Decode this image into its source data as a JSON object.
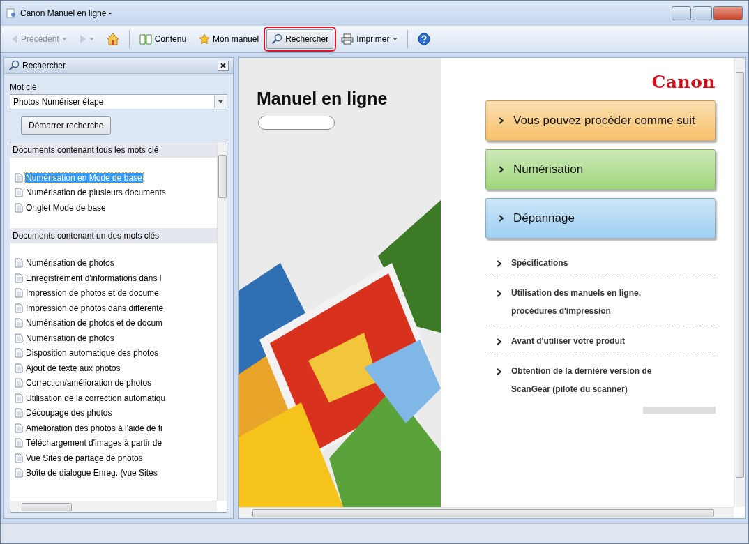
{
  "window": {
    "title": "Canon Manuel en ligne -"
  },
  "toolbar": [
    {
      "kind": "back",
      "label": "Précédent",
      "disabled": true,
      "selected": false
    },
    {
      "kind": "forward",
      "disabled": true,
      "selected": false
    },
    {
      "kind": "home",
      "disabled": false,
      "selected": false
    },
    {
      "kind": "contents",
      "label": "Contenu",
      "disabled": false,
      "selected": false
    },
    {
      "kind": "favorites",
      "label": "Mon manuel",
      "disabled": false,
      "selected": false
    },
    {
      "kind": "search",
      "label": "Rechercher",
      "disabled": false,
      "selected": true
    },
    {
      "kind": "print",
      "label": "Imprimer",
      "disabled": false,
      "selected": false
    },
    {
      "kind": "help",
      "disabled": false,
      "selected": false
    }
  ],
  "search_panel": {
    "title": "Rechercher",
    "keyword_label": "Mot clé",
    "keyword_value": "Photos Numériser étape",
    "start_button": "Démarrer recherche",
    "groups": [
      {
        "heading": "Documents contenant tous les mots clé",
        "items": [
          {
            "label": "Numérisation en Mode de base",
            "selected": true
          },
          {
            "label": "Numérisation de plusieurs documents",
            "selected": false
          },
          {
            "label": "Onglet Mode de base",
            "selected": false
          }
        ]
      },
      {
        "heading": "Documents contenant un des mots clés",
        "items": [
          {
            "label": "Numérisation de photos",
            "selected": false
          },
          {
            "label": "Enregistrement d'informations dans l",
            "selected": false
          },
          {
            "label": "Impression de photos et de docume",
            "selected": false
          },
          {
            "label": "Impression de photos dans différente",
            "selected": false
          },
          {
            "label": "Numérisation de photos et de docum",
            "selected": false
          },
          {
            "label": "Numérisation de photos",
            "selected": false
          },
          {
            "label": "Disposition automatique des photos",
            "selected": false
          },
          {
            "label": "Ajout de texte aux photos",
            "selected": false
          },
          {
            "label": "Correction/amélioration de photos",
            "selected": false
          },
          {
            "label": "Utilisation de la correction automatiqu",
            "selected": false
          },
          {
            "label": "Découpage des photos",
            "selected": false
          },
          {
            "label": "Amélioration des photos à l'aide de fi",
            "selected": false
          },
          {
            "label": "Téléchargement d'images à partir de",
            "selected": false
          },
          {
            "label": "Vue Sites de partage de photos",
            "selected": false
          },
          {
            "label": "Boîte de dialogue Enreg. (vue Sites",
            "selected": false
          }
        ]
      }
    ]
  },
  "content": {
    "title": "Manuel en ligne",
    "logo": "Canon",
    "main_links": [
      {
        "label": "Vous pouvez procéder comme suit",
        "color": "#f7c16a"
      },
      {
        "label": "Numérisation",
        "color": "#9fd67a"
      },
      {
        "label": "Dépannage",
        "color": "#9fd0f2"
      }
    ],
    "links": [
      {
        "lines": [
          "Spécifications"
        ]
      },
      {
        "lines": [
          "Utilisation des manuels en ligne,",
          "procédures d'impression"
        ]
      },
      {
        "lines": [
          "Avant d'utiliser votre produit"
        ]
      },
      {
        "lines": [
          "Obtention de la dernière version de",
          "ScanGear (pilote du scanner)"
        ]
      }
    ]
  }
}
